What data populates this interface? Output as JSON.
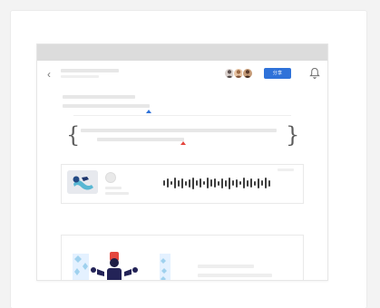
{
  "toolbar": {
    "primary_button_label": "分享"
  },
  "icons": {
    "back": "chevron-left-icon",
    "bell": "bell-icon",
    "audio": "audio-icon",
    "waveform": "waveform-icon",
    "illustration": "illustration-icon"
  },
  "colors": {
    "primary": "#2f72d9",
    "alert": "#e4473f",
    "text_dark": "#3f3f3f",
    "placeholder": "#e7e7e7"
  }
}
